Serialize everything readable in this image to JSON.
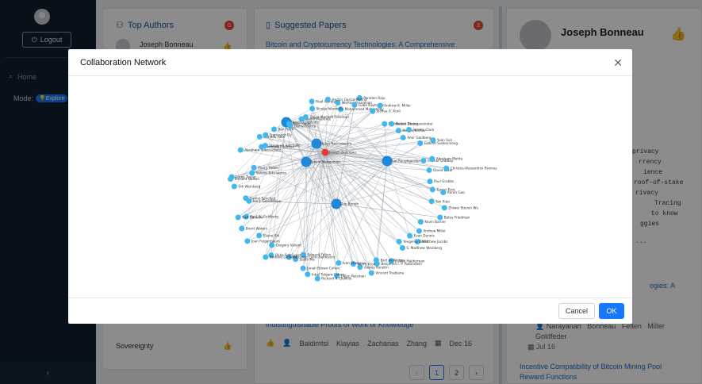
{
  "sidebar": {
    "logout_label": "Logout",
    "home_label": "Home",
    "mode_label": "Mode:",
    "mode_value": "Explore",
    "collapse_icon": "‹"
  },
  "authors_card": {
    "title": "Top Authors",
    "count": "0",
    "first_author": "Joseph Bonneau",
    "last_item": "Sovereignty"
  },
  "papers_card": {
    "title": "Suggested Papers",
    "count": "3",
    "first_paper": "Bitcoin and Cryptocurrency Technologies: A Comprehensive",
    "second_paper_fragment": "Indistinguishable Proofs of Work or Knowledge",
    "authors": [
      "Baldimtsi",
      "Kiayias",
      "Zacharias",
      "Zhang"
    ],
    "date": "Dec 16",
    "pages": [
      "1",
      "2"
    ]
  },
  "profile": {
    "name": "Joseph Bonneau",
    "snippet_lines": [
      "privacy",
      "rrency",
      "ience",
      "roof-of-stake",
      "rivacy",
      "Tracing",
      "to know",
      "ggies",
      "..."
    ],
    "paper_fragment": "ogies: A",
    "paper_authors": [
      "Narayanan",
      "Bonneau",
      "Felten",
      "Miller",
      "Goldfeder"
    ],
    "paper_date": "Jul 16",
    "next_paper": "Incentive Compatibility of Bitcoin Mining Pool Reward Functions"
  },
  "modal": {
    "title": "Collaboration Network",
    "cancel_label": "Cancel",
    "ok_label": "OK"
  },
  "colors": {
    "node": "#40b8ee",
    "hub": "#1f88d8",
    "focus": "#e23b2e",
    "edge": "#9aa3ad",
    "accent": "#1677ff"
  },
  "network": {
    "focus": "Joseph Bonneau",
    "nodes": [
      {
        "name": "Michael Freedman",
        "hub": false
      },
      {
        "name": "Mohammad Mahmoody",
        "hub": false
      },
      {
        "name": "Gabe Kaptchuk",
        "hub": false
      },
      {
        "name": "Pandian Raju",
        "hub": false
      },
      {
        "name": "Joshua A. Kroll",
        "hub": false
      },
      {
        "name": "Andrew K. Miller",
        "hub": false
      },
      {
        "name": "Emmanuel Dhangaveirotai",
        "hub": false
      },
      {
        "name": "Mathis Baden",
        "hub": false
      },
      {
        "name": "Maxim Kirillov",
        "hub": false
      },
      {
        "name": "Jeremy Clark",
        "hub": false
      },
      {
        "name": "Amir Goldberg",
        "hub": false
      },
      {
        "name": "Yuan Sun",
        "hub": false
      },
      {
        "name": "Gabriel Sukkarinovg",
        "hub": false
      },
      {
        "name": "Steven Goldfeder",
        "hub": true
      },
      {
        "name": "Shahar Gabbay",
        "hub": false
      },
      {
        "name": "Abraham Mehta",
        "hub": false
      },
      {
        "name": "David Lazar",
        "hub": false
      },
      {
        "name": "Christos-Alexandros Psomas",
        "hub": false
      },
      {
        "name": "Paul Grubbs",
        "hub": false
      },
      {
        "name": "Tumer Ezra",
        "hub": false
      },
      {
        "name": "Aaron Gao",
        "hub": false
      },
      {
        "name": "Yan Xiao",
        "hub": false
      },
      {
        "name": "Zhiwei Steven Wu",
        "hub": false
      },
      {
        "name": "Betsy Friedman",
        "hub": false
      },
      {
        "name": "Helen Nissenbaum",
        "hub": true
      },
      {
        "name": "Kevin Barner",
        "hub": false
      },
      {
        "name": "Andrew Miller",
        "hub": false
      },
      {
        "name": "Matthew Jacobs",
        "hub": false
      },
      {
        "name": "Evan Dennis",
        "hub": false
      },
      {
        "name": "Yevgeniy Dodis",
        "hub": false
      },
      {
        "name": "Arvind Narayanan",
        "hub": true
      },
      {
        "name": "Tim Roughgarden",
        "hub": true
      },
      {
        "name": "S. Matthew Weinberg",
        "hub": false
      },
      {
        "name": "J. Alex Halderman",
        "hub": false
      },
      {
        "name": "Bart de Keijzer",
        "hub": false
      },
      {
        "name": "Benjamin I. P. Rubinstein",
        "hub": false
      },
      {
        "name": "Vincent Toubiana",
        "hub": false
      },
      {
        "name": "Alexey Kurakin",
        "hub": false
      },
      {
        "name": "Pierre Kroll",
        "hub": false
      },
      {
        "name": "Ivan Shalunov",
        "hub": false
      },
      {
        "name": "Dillon Reisman",
        "hub": false
      },
      {
        "name": "Richard A. DeMillo",
        "hub": false
      },
      {
        "name": "Inbal Talgam-Cohen",
        "hub": false
      },
      {
        "name": "Jonah Brown-Cohen",
        "hub": false
      },
      {
        "name": "Edward Felten",
        "hub": false
      },
      {
        "name": "Justin Ma",
        "hub": false
      },
      {
        "name": "Riccardo Colini-Baldeschi",
        "hub": false
      },
      {
        "name": "Okke Schrijvers",
        "hub": false
      },
      {
        "name": "Stefano Leonardi",
        "hub": false
      },
      {
        "name": "Dan Boneh",
        "hub": true
      },
      {
        "name": "Gregory Valiant",
        "hub": false
      },
      {
        "name": "Elaine Shi",
        "hub": false
      },
      {
        "name": "Joan Feigenbaum",
        "hub": false
      },
      {
        "name": "Brent Waters",
        "hub": false
      },
      {
        "name": "Paul W. Goldberg",
        "hub": false
      },
      {
        "name": "Neil Daswani",
        "hub": false
      },
      {
        "name": "Daniel Sanchez",
        "hub": false
      },
      {
        "name": "Ian J. Goodfellow",
        "hub": false
      },
      {
        "name": "Udi Weinberg",
        "hub": false
      },
      {
        "name": "Richard Nelson",
        "hub": false
      },
      {
        "name": "Lorne Trevor",
        "hub": false
      },
      {
        "name": "Valeria Nikolaenko",
        "hub": false
      },
      {
        "name": "Paul J. Reber",
        "hub": false
      },
      {
        "name": "Abraham Silberschatz",
        "hub": false
      },
      {
        "name": "Andreas Freeman",
        "hub": false
      },
      {
        "name": "Steven P. Ketchpel",
        "hub": false
      },
      {
        "name": "Hendrik Rios",
        "hub": false
      },
      {
        "name": "Francesco Dy",
        "hub": false
      },
      {
        "name": "Ben Fisch",
        "hub": false
      },
      {
        "name": "Mike Kwon",
        "hub": false
      },
      {
        "name": "Darryl Mehta",
        "hub": false
      },
      {
        "name": "David Mazieres",
        "hub": false
      },
      {
        "name": "David Mandell Freeman",
        "hub": false
      },
      {
        "name": "Stratis Ioannidis",
        "hub": false
      },
      {
        "name": "Riad Wahby",
        "hub": false
      },
      {
        "name": "Hector Garcia-Molina",
        "hub": false
      }
    ]
  }
}
